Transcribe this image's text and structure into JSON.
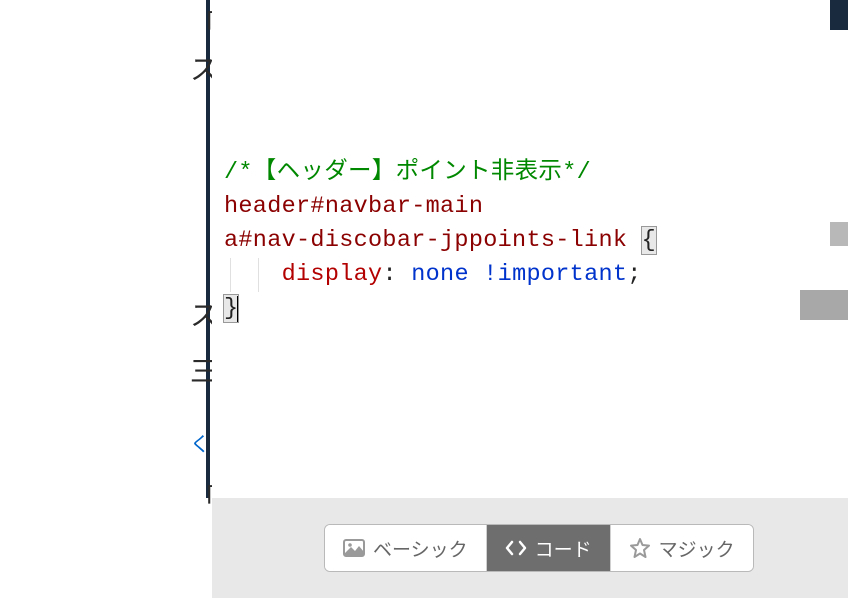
{
  "code": {
    "comment": "/*【ヘッダー】ポイント非表示*/",
    "selector_line1": "header#navbar-main",
    "selector_line2": "a#nav-discobar-jppoints-link",
    "open_brace": "{",
    "indent": "    ",
    "prop": "display",
    "colon_sp": ": ",
    "value": "none",
    "sp": " ",
    "important": "!important",
    "semicolon": ";",
    "close_brace": "}"
  },
  "left_fragments": {
    "f1": "「",
    "f2": "ス",
    "f3": "ス",
    "f4": "三",
    "f5": "く",
    "f6": "「"
  },
  "toolbar": {
    "basic_label": "ベーシック",
    "code_label": "コード",
    "magic_label": "マジック"
  }
}
